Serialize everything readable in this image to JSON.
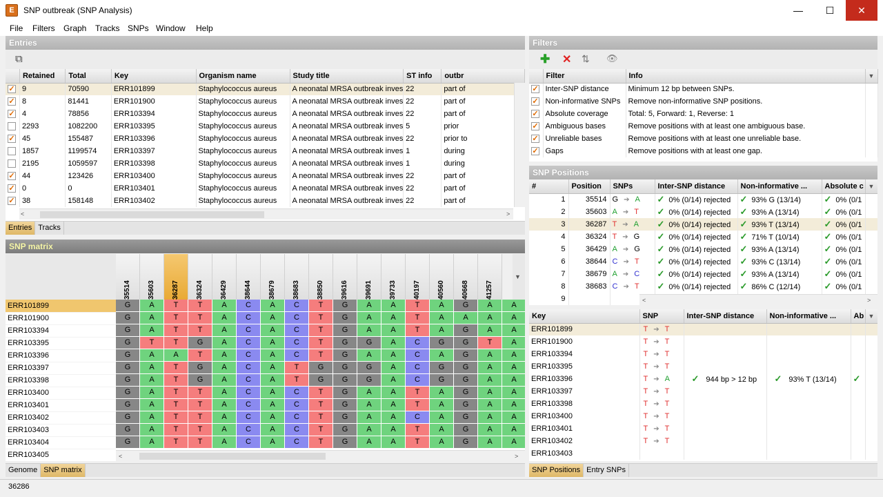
{
  "window": {
    "title": "SNP outbreak (SNP Analysis)",
    "app_icon": "E",
    "min": "—",
    "max": "☐",
    "close": "✕"
  },
  "menu": [
    "File",
    "Filters",
    "Graph",
    "Tracks",
    "SNPs",
    "Window",
    "Help"
  ],
  "entries": {
    "title": "Entries",
    "columns": [
      "Retained",
      "Total",
      "Key",
      "Organism name",
      "Study title",
      "ST info",
      "outbr"
    ],
    "rows": [
      {
        "checked": true,
        "retained": "9",
        "total": "70590",
        "key": "ERR101899",
        "org": "Staphylococcus aureus",
        "study": "A neonatal MRSA outbreak investigation usin...",
        "st": "22",
        "outbr": "part of"
      },
      {
        "checked": true,
        "retained": "8",
        "total": "81441",
        "key": "ERR101900",
        "org": "Staphylococcus aureus",
        "study": "A neonatal MRSA outbreak investigation usin...",
        "st": "22",
        "outbr": "part of"
      },
      {
        "checked": true,
        "retained": "4",
        "total": "78856",
        "key": "ERR103394",
        "org": "Staphylococcus aureus",
        "study": "A neonatal MRSA outbreak investigation usin...",
        "st": "22",
        "outbr": "part of"
      },
      {
        "checked": false,
        "retained": "2293",
        "total": "1082200",
        "key": "ERR103395",
        "org": "Staphylococcus aureus",
        "study": "A neonatal MRSA outbreak investigation usin...",
        "st": "5",
        "outbr": "prior"
      },
      {
        "checked": true,
        "retained": "45",
        "total": "155487",
        "key": "ERR103396",
        "org": "Staphylococcus aureus",
        "study": "A neonatal MRSA outbreak investigation usin...",
        "st": "22",
        "outbr": "prior to"
      },
      {
        "checked": false,
        "retained": "1857",
        "total": "1199574",
        "key": "ERR103397",
        "org": "Staphylococcus aureus",
        "study": "A neonatal MRSA outbreak investigation usin...",
        "st": "1",
        "outbr": "during"
      },
      {
        "checked": false,
        "retained": "2195",
        "total": "1059597",
        "key": "ERR103398",
        "org": "Staphylococcus aureus",
        "study": "A neonatal MRSA outbreak investigation usin...",
        "st": "1",
        "outbr": "during"
      },
      {
        "checked": true,
        "retained": "44",
        "total": "123426",
        "key": "ERR103400",
        "org": "Staphylococcus aureus",
        "study": "A neonatal MRSA outbreak investigation usin...",
        "st": "22",
        "outbr": "part of"
      },
      {
        "checked": true,
        "retained": "0",
        "total": "0",
        "key": "ERR103401",
        "org": "Staphylococcus aureus",
        "study": "A neonatal MRSA outbreak investigation usin...",
        "st": "22",
        "outbr": "part of"
      },
      {
        "checked": true,
        "retained": "38",
        "total": "158148",
        "key": "ERR103402",
        "org": "Staphylococcus aureus",
        "study": "A neonatal MRSA outbreak investigation usin...",
        "st": "22",
        "outbr": "part of"
      }
    ],
    "tabs": [
      "Entries",
      "Tracks"
    ]
  },
  "filters": {
    "title": "Filters",
    "columns": [
      "Filter",
      "Info"
    ],
    "rows": [
      {
        "name": "Inter-SNP distance",
        "info": "Minimum 12 bp between SNPs."
      },
      {
        "name": "Non-informative SNPs",
        "info": "Remove non-informative SNP positions."
      },
      {
        "name": "Absolute coverage",
        "info": "Total: 5, Forward: 1, Reverse: 1"
      },
      {
        "name": "Ambiguous bases",
        "info": "Remove positions with at least one ambiguous base."
      },
      {
        "name": "Unreliable bases",
        "info": "Remove positions with at least one unreliable base."
      },
      {
        "name": "Gaps",
        "info": "Remove positions with at least one gap."
      }
    ]
  },
  "snp_positions": {
    "title": "SNP Positions",
    "columns": [
      "#",
      "Position",
      "SNPs",
      "Inter-SNP distance",
      "Non-informative ...",
      "Absolute c"
    ],
    "rows": [
      {
        "n": "1",
        "pos": "35514",
        "from": "G",
        "to": "A",
        "dist": "0% (0/14) rejected",
        "noninf": "93% G (13/14)",
        "abs": "0% (0/1"
      },
      {
        "n": "2",
        "pos": "35603",
        "from": "A",
        "to": "T",
        "dist": "0% (0/14) rejected",
        "noninf": "93% A (13/14)",
        "abs": "0% (0/1"
      },
      {
        "n": "3",
        "pos": "36287",
        "from": "T",
        "to": "A",
        "dist": "0% (0/14) rejected",
        "noninf": "93% T (13/14)",
        "abs": "0% (0/1"
      },
      {
        "n": "4",
        "pos": "36324",
        "from": "T",
        "to": "G",
        "dist": "0% (0/14) rejected",
        "noninf": "71% T (10/14)",
        "abs": "0% (0/1"
      },
      {
        "n": "5",
        "pos": "36429",
        "from": "A",
        "to": "G",
        "dist": "0% (0/14) rejected",
        "noninf": "93% A (13/14)",
        "abs": "0% (0/1"
      },
      {
        "n": "6",
        "pos": "38644",
        "from": "C",
        "to": "T",
        "dist": "0% (0/14) rejected",
        "noninf": "93% C (13/14)",
        "abs": "0% (0/1"
      },
      {
        "n": "7",
        "pos": "38679",
        "from": "A",
        "to": "C",
        "dist": "0% (0/14) rejected",
        "noninf": "93% A (13/14)",
        "abs": "0% (0/1"
      },
      {
        "n": "8",
        "pos": "38683",
        "from": "C",
        "to": "T",
        "dist": "0% (0/14) rejected",
        "noninf": "86% C (12/14)",
        "abs": "0% (0/1"
      },
      {
        "n": "9",
        "pos": "",
        "from": "",
        "to": "",
        "dist": "",
        "noninf": "",
        "abs": ""
      }
    ]
  },
  "snp_matrix": {
    "title": "SNP matrix",
    "positions": [
      "35514",
      "35603",
      "36287",
      "36324",
      "36429",
      "38644",
      "38679",
      "38683",
      "38850",
      "39616",
      "39691",
      "39733",
      "40197",
      "40560",
      "40668",
      "41257"
    ],
    "highlight_col": 2,
    "rows": [
      {
        "key": "ERR101899",
        "bases": "GATTACACTGAATAGAA"
      },
      {
        "key": "ERR101900",
        "bases": "GATTACACTGAATAAAA"
      },
      {
        "key": "ERR103394",
        "bases": "GATTACACTGAATAGAA"
      },
      {
        "key": "ERR103395",
        "bases": "GTTGACACTGGACGGTA"
      },
      {
        "key": "ERR103396",
        "bases": "GAATACACTGAACAGAA"
      },
      {
        "key": "ERR103397",
        "bases": "GATGACATGGGACGGAA"
      },
      {
        "key": "ERR103398",
        "bases": "GATGACATGGGACGGAA"
      },
      {
        "key": "ERR103400",
        "bases": "GATTACACTGAATAGAA"
      },
      {
        "key": "ERR103401",
        "bases": "GATTACACTGAATAGAA"
      },
      {
        "key": "ERR103402",
        "bases": "GATTACACTGAACAGAA"
      },
      {
        "key": "ERR103403",
        "bases": "GATTACACTGAATAGAA"
      },
      {
        "key": "ERR103404",
        "bases": "GATTACACTGAATAGAA"
      },
      {
        "key": "ERR103405",
        "bases": ""
      }
    ],
    "tabs": [
      "Genome",
      "SNP matrix"
    ]
  },
  "entry_snps": {
    "columns": [
      "Key",
      "SNP",
      "Inter-SNP distance",
      "Non-informative ...",
      "Ab"
    ],
    "rows": [
      {
        "key": "ERR101899",
        "from": "T",
        "to": "T",
        "dist": "",
        "noninf": ""
      },
      {
        "key": "ERR101900",
        "from": "T",
        "to": "T",
        "dist": "",
        "noninf": ""
      },
      {
        "key": "ERR103394",
        "from": "T",
        "to": "T",
        "dist": "",
        "noninf": ""
      },
      {
        "key": "ERR103395",
        "from": "T",
        "to": "T",
        "dist": "",
        "noninf": ""
      },
      {
        "key": "ERR103396",
        "from": "T",
        "to": "A",
        "dist": "944 bp > 12 bp",
        "noninf": "93% T (13/14)"
      },
      {
        "key": "ERR103397",
        "from": "T",
        "to": "T",
        "dist": "",
        "noninf": ""
      },
      {
        "key": "ERR103398",
        "from": "T",
        "to": "T",
        "dist": "",
        "noninf": ""
      },
      {
        "key": "ERR103400",
        "from": "T",
        "to": "T",
        "dist": "",
        "noninf": ""
      },
      {
        "key": "ERR103401",
        "from": "T",
        "to": "T",
        "dist": "",
        "noninf": ""
      },
      {
        "key": "ERR103402",
        "from": "T",
        "to": "T",
        "dist": "",
        "noninf": ""
      },
      {
        "key": "ERR103403",
        "from": "",
        "to": "",
        "dist": "",
        "noninf": ""
      }
    ],
    "tabs": [
      "SNP Positions",
      "Entry SNPs"
    ]
  },
  "status": {
    "text": "36286"
  },
  "colors": {
    "A": "#6fd37e",
    "C": "#8a8af0",
    "G": "#878787",
    "T": "#f57d7d",
    "tab_active": "#e8c27a"
  },
  "icons": {
    "check": "✓",
    "arrow": "➔"
  }
}
